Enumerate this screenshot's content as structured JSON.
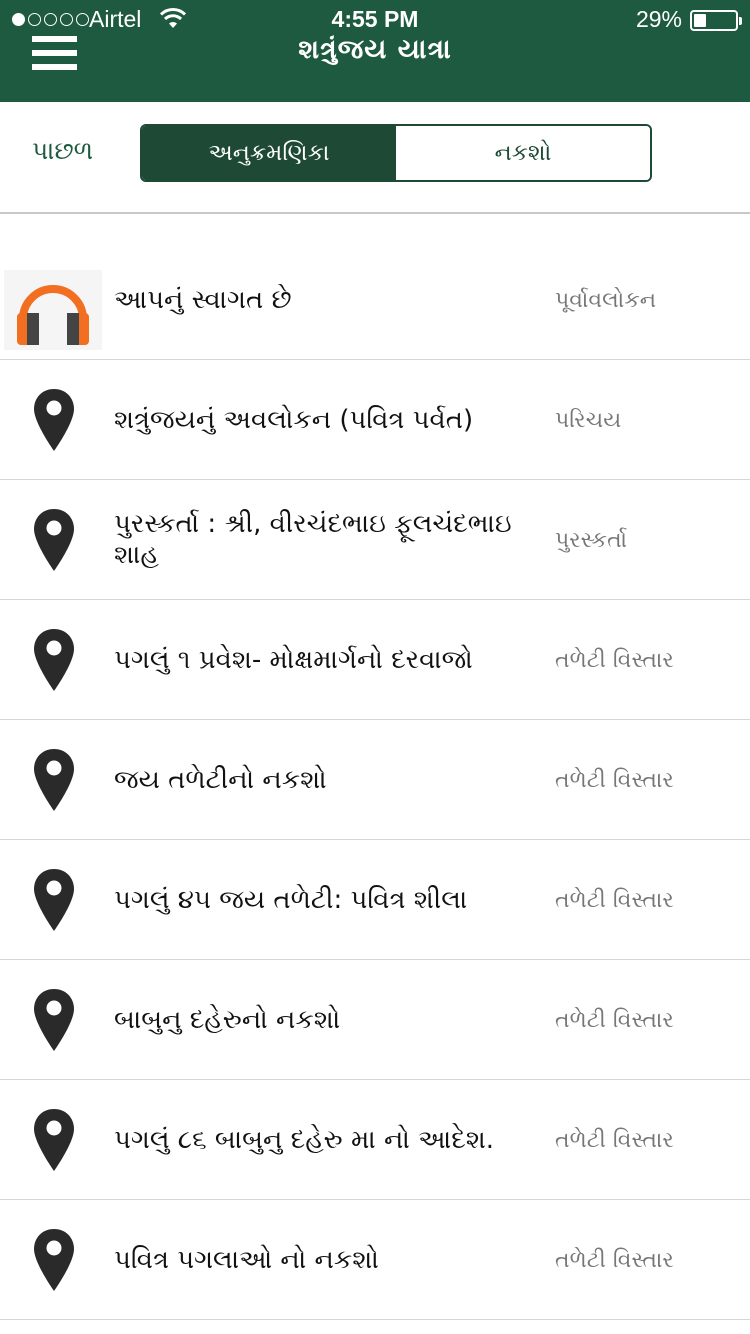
{
  "status_bar": {
    "carrier": "Airtel",
    "time": "4:55 PM",
    "battery_percent": "29%",
    "battery_level": 0.29,
    "signal_bars_filled": 1,
    "signal_bars_total": 5
  },
  "header": {
    "title": "શત્રુંજય યાત્રા",
    "menu_icon": "hamburger-menu-icon",
    "background_color": "#1e5a3f"
  },
  "toolbar": {
    "back_label": "પાછળ",
    "tabs": [
      {
        "label": "અનુક્રમણિકા",
        "active": true
      },
      {
        "label": "નકશો",
        "active": false
      }
    ]
  },
  "list": {
    "items": [
      {
        "title": "આપનું સ્વાગત છે",
        "category": "પૂર્વાવલોકન",
        "icon": "headphones-icon"
      },
      {
        "title": "શત્રુંજયનું અવલોકન (પવિત્ર પર્વત)",
        "category": "પરિચય",
        "icon": "map-pin-icon"
      },
      {
        "title": "પુરસ્કર્તા : શ્રી, વીરચંદભાઇ ફૂલચંદભાઇ શાહ",
        "category": "પુરસ્કર્તા",
        "icon": "map-pin-icon"
      },
      {
        "title": "પગલું ૧ પ્રવેશ- મોક્ષમાર્ગનો દરવાજો",
        "category": "તળેટી વિસ્તાર",
        "icon": "map-pin-icon"
      },
      {
        "title": "જય તળેટીનો નકશો",
        "category": "તળેટી વિસ્તાર",
        "icon": "map-pin-icon"
      },
      {
        "title": "પગલું ૪૫ જય તળેટી: પવિત્ર શીલા",
        "category": "તળેટી વિસ્તાર",
        "icon": "map-pin-icon"
      },
      {
        "title": "બાબુનુ દહેરુનો નકશો",
        "category": "તળેટી વિસ્તાર",
        "icon": "map-pin-icon"
      },
      {
        "title": "પગલું ૮૬ બાબુનુ દહેરુ મા નો આદેશ.",
        "category": "તળેટી વિસ્તાર",
        "icon": "map-pin-icon"
      },
      {
        "title": "પવિત્ર પગલાઓ નો નકશો",
        "category": "તળેટી વિસ્તાર",
        "icon": "map-pin-icon"
      }
    ]
  }
}
